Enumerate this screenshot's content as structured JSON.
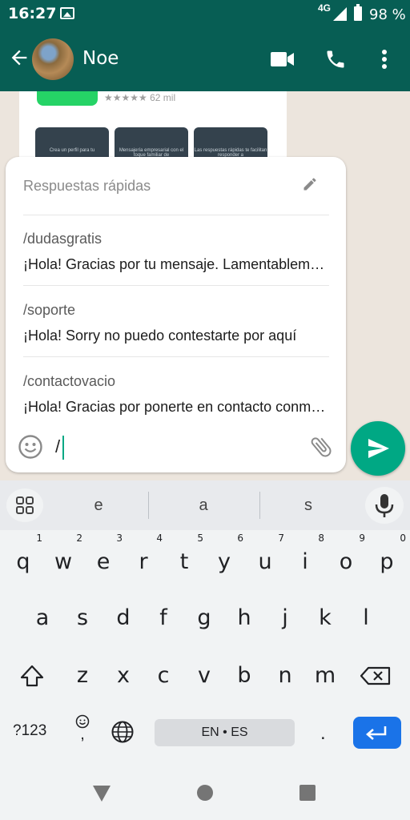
{
  "status_bar": {
    "time": "16:27",
    "network": "4G",
    "battery": "98 %"
  },
  "header": {
    "contact_name": "Noe"
  },
  "chat_preview": {
    "rating_text": "★★★★★ 62 mil",
    "cards": [
      "Crea un perfil para tu",
      "Mensajería empresarial con el toque familiar de",
      "Las respuestas rápidas te facilitan responder a"
    ]
  },
  "quick_replies": {
    "title": "Respuestas rápidas",
    "items": [
      {
        "shortcut": "/dudasgratis",
        "message": "¡Hola! Gracias por tu mensaje. Lamentablemente"
      },
      {
        "shortcut": "/soporte",
        "message": "¡Hola! Sorry no puedo contestarte por aquí"
      },
      {
        "shortcut": "/contactovacio",
        "message": "¡Hola! Gracias por ponerte en contacto conmigo"
      }
    ]
  },
  "composer": {
    "input_value": "/"
  },
  "keyboard": {
    "suggestions": [
      "e",
      "a",
      "s"
    ],
    "row1": [
      {
        "k": "q",
        "n": "1"
      },
      {
        "k": "w",
        "n": "2"
      },
      {
        "k": "e",
        "n": "3"
      },
      {
        "k": "r",
        "n": "4"
      },
      {
        "k": "t",
        "n": "5"
      },
      {
        "k": "y",
        "n": "6"
      },
      {
        "k": "u",
        "n": "7"
      },
      {
        "k": "i",
        "n": "8"
      },
      {
        "k": "o",
        "n": "9"
      },
      {
        "k": "p",
        "n": "0"
      }
    ],
    "row2": [
      "a",
      "s",
      "d",
      "f",
      "g",
      "h",
      "j",
      "k",
      "l"
    ],
    "row3": [
      "z",
      "x",
      "c",
      "v",
      "b",
      "n",
      "m"
    ],
    "symbols_label": "?123",
    "comma": ",",
    "space_label": "EN • ES",
    "period": "."
  },
  "colors": {
    "header": "#075e54",
    "accent": "#00a884",
    "keyboard_enter": "#1a73e8"
  }
}
